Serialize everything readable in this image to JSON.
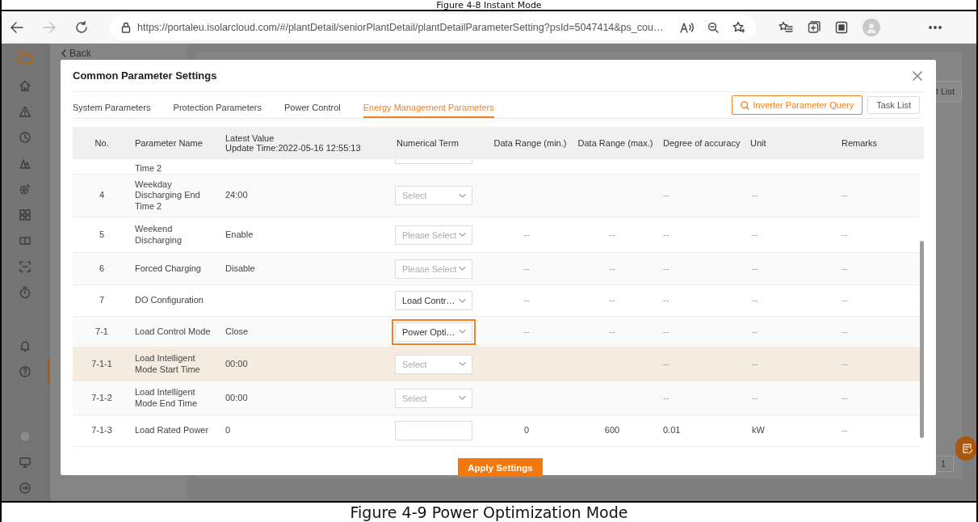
{
  "captions": {
    "top": "Figure 4-8 Instant Mode",
    "bottom": "Figure 4-9 Power Optimization Mode"
  },
  "browser": {
    "forward_disabled": true,
    "url": "https://portaleu.isolarcloud.com/#/plantDetail/seniorPlantDetail/plantDetailParameterSetting?psId=5047414&ps_cou…"
  },
  "sidebar": {
    "groups": [
      [
        {
          "kind": "home",
          "selected": false
        },
        {
          "kind": "alert",
          "selected": false
        },
        {
          "kind": "clock",
          "selected": false
        },
        {
          "kind": "chart",
          "selected": false
        },
        {
          "kind": "device",
          "selected": false
        },
        {
          "kind": "grid",
          "selected": false
        },
        {
          "kind": "card",
          "selected": false
        },
        {
          "kind": "scan",
          "selected": false
        },
        {
          "kind": "timer",
          "selected": false
        }
      ],
      [
        {
          "kind": "bell",
          "selected": false
        },
        {
          "kind": "help",
          "selected": true
        }
      ],
      [
        {
          "kind": "dot",
          "selected": false
        },
        {
          "kind": "monitor",
          "selected": false
        },
        {
          "kind": "logout",
          "selected": false
        }
      ]
    ]
  },
  "background": {
    "back_link": "Back",
    "task_list_button": "t List",
    "page_number": "1"
  },
  "modal": {
    "title": "Common Parameter Settings",
    "tabs": [
      {
        "label": "System Parameters",
        "selected": false
      },
      {
        "label": "Protection Parameters",
        "selected": false
      },
      {
        "label": "Power Control",
        "selected": false
      },
      {
        "label": "Energy Management Parameters",
        "selected": true
      }
    ],
    "query_button": "Inverter Parameter Query",
    "task_button": "Task List",
    "table": {
      "columns": [
        {
          "label": "No."
        },
        {
          "label": "Parameter Name"
        },
        {
          "label": "Latest Value",
          "note": "Update Time:2022-05-16 12:55:13"
        },
        {
          "label": "Numerical Term"
        },
        {
          "label": "Data Range (min.)"
        },
        {
          "label": "Data Range (max.)"
        },
        {
          "label": "Degree of accuracy"
        },
        {
          "label": "Unit"
        },
        {
          "label": "Remarks"
        }
      ],
      "partial_row": {
        "name": "Time 2"
      },
      "rows": [
        {
          "no": "4",
          "name": "Weekday Discharging End Time 2",
          "latest": "24:00",
          "term": {
            "kind": "select",
            "placeholder": "Select"
          },
          "accuracy": "--",
          "unit": "--",
          "remarks": "--",
          "hovered": false,
          "highlighted": false
        },
        {
          "no": "5",
          "name": "Weekend Discharging",
          "latest": "Enable",
          "term": {
            "kind": "select",
            "placeholder": "Please Select"
          },
          "min": "--",
          "max": "--",
          "accuracy": "--",
          "unit": "--",
          "remarks": "--",
          "hovered": false,
          "highlighted": false
        },
        {
          "no": "6",
          "name": "Forced Charging",
          "latest": "Disable",
          "term": {
            "kind": "select",
            "placeholder": "Please Select"
          },
          "min": "--",
          "max": "--",
          "accuracy": "--",
          "unit": "--",
          "remarks": "--",
          "hovered": false,
          "highlighted": false
        },
        {
          "no": "7",
          "name": "DO Configuration",
          "term": {
            "kind": "select",
            "value": "Load Contr…"
          },
          "min": "--",
          "max": "--",
          "accuracy": "--",
          "unit": "--",
          "remarks": "--",
          "hovered": false,
          "highlighted": false
        },
        {
          "no": "7-1",
          "name": "Load Control Mode",
          "latest": "Close",
          "term": {
            "kind": "select",
            "value": "Power Opti…"
          },
          "min": "--",
          "max": "--",
          "accuracy": "--",
          "unit": "--",
          "remarks": "--",
          "hovered": false,
          "highlighted": true
        },
        {
          "no": "7-1-1",
          "name": "Load Intelligent Mode Start Time",
          "latest": "00:00",
          "term": {
            "kind": "select",
            "placeholder": "Select"
          },
          "accuracy": "--",
          "unit": "--",
          "remarks": "--",
          "hovered": true,
          "highlighted": false
        },
        {
          "no": "7-1-2",
          "name": "Load Intelligent Mode End Time",
          "latest": "00:00",
          "term": {
            "kind": "select",
            "placeholder": "Select"
          },
          "accuracy": "--",
          "unit": "--",
          "remarks": "--",
          "hovered": false,
          "highlighted": false
        },
        {
          "no": "7-1-3",
          "name": "Load Rated Power",
          "latest": "0",
          "term": {
            "kind": "input"
          },
          "min": "0",
          "max": "600",
          "accuracy": "0.01",
          "unit": "kW",
          "remarks": "--",
          "hovered": false,
          "highlighted": false
        }
      ]
    },
    "apply_button": "Apply Settings"
  }
}
